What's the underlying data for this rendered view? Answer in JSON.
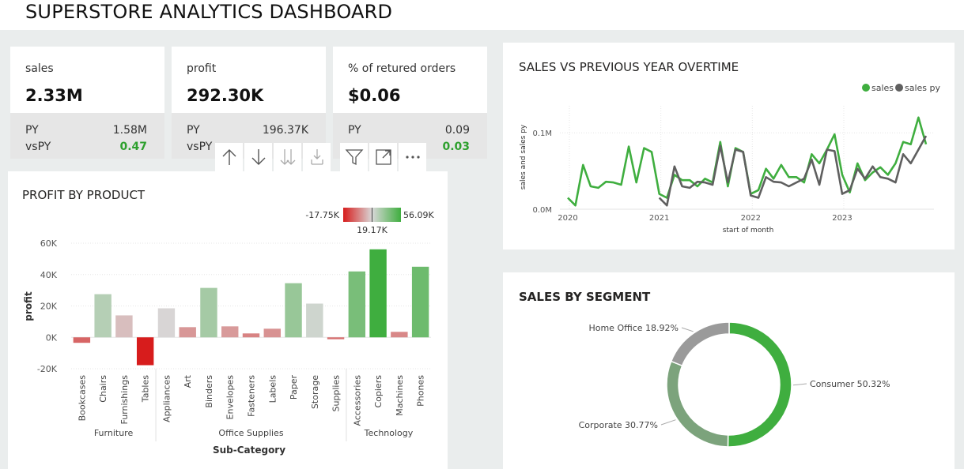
{
  "title": "SUPERSTORE ANALYTICS DASHBOARD",
  "kpis": [
    {
      "label": "sales",
      "value": "2.33M",
      "py_label": "PY",
      "py_value": "1.58M",
      "vspy_label": "vsPY",
      "vspy_value": "0.47"
    },
    {
      "label": "profit",
      "value": "292.30K",
      "py_label": "PY",
      "py_value": "196.37K",
      "vspy_label": "vsPY",
      "vspy_value": ""
    },
    {
      "label": "% of retured orders",
      "value": "$0.06",
      "py_label": "PY",
      "py_value": "0.09",
      "vspy_label": "vs",
      "vspy_value": "0.03"
    }
  ],
  "toolbar_icons": [
    "arrow-up-icon",
    "arrow-down-icon",
    "double-arrow-down-icon",
    "expand-hierarchy-icon",
    "filter-icon",
    "focus-mode-icon",
    "more-options-icon"
  ],
  "colors": {
    "accent_green": "#3fae3f",
    "grey_line": "#5f5f5f",
    "negative_red": "#d71c1c"
  },
  "profit_panel": {
    "title": "PROFIT BY PRODUCT"
  },
  "line_panel": {
    "title": "SALES VS PREVIOUS YEAR OVERTIME"
  },
  "donut_panel": {
    "title": "SALES BY SEGMENT"
  },
  "chart_data": [
    {
      "type": "bar",
      "title": "PROFIT BY PRODUCT",
      "xlabel": "Sub-Category",
      "ylabel": "profit",
      "ylim": [
        -20000,
        60000
      ],
      "yticks": [
        -20000,
        0,
        20000,
        40000,
        60000
      ],
      "ytick_labels": [
        "-20K",
        "0K",
        "20K",
        "40K",
        "60K"
      ],
      "legend": {
        "type": "gradient",
        "min_label": "-17.75K",
        "mid_label": "19.17K",
        "max_label": "56.09K",
        "min": -17750,
        "mid": 19170,
        "max": 56090
      },
      "groups": [
        {
          "name": "Furniture",
          "categories": [
            "Bookcases",
            "Chairs",
            "Furnishings",
            "Tables"
          ],
          "values": [
            -3500,
            27500,
            14000,
            -17750
          ]
        },
        {
          "name": "Office Supplies",
          "categories": [
            "Appliances",
            "Art",
            "Binders",
            "Envelopes",
            "Fasteners",
            "Labels",
            "Paper",
            "Storage",
            "Supplies"
          ],
          "values": [
            18500,
            6500,
            31500,
            7000,
            2500,
            5500,
            34500,
            21500,
            -1200
          ]
        },
        {
          "name": "Technology",
          "categories": [
            "Accessories",
            "Copiers",
            "Machines",
            "Phones"
          ],
          "values": [
            42000,
            56090,
            3500,
            45000
          ]
        }
      ]
    },
    {
      "type": "line",
      "title": "SALES VS PREVIOUS YEAR OVERTIME",
      "xlabel": "start of month",
      "ylabel": "sales and sales py",
      "x_start": "2020-01",
      "x_ticks": [
        "2020",
        "2021",
        "2022",
        "2023"
      ],
      "ytick_labels": [
        "0.0M",
        "0.1M"
      ],
      "yticks": [
        0,
        0.1
      ],
      "ylim": [
        0,
        0.125
      ],
      "legend_position": "top-right",
      "series": [
        {
          "name": "sales",
          "color": "#3fae3f",
          "values": [
            0.015,
            0.005,
            0.058,
            0.03,
            0.028,
            0.036,
            0.035,
            0.032,
            0.082,
            0.035,
            0.08,
            0.075,
            0.02,
            0.015,
            0.045,
            0.038,
            0.038,
            0.03,
            0.04,
            0.035,
            0.088,
            0.03,
            0.08,
            0.075,
            0.02,
            0.025,
            0.053,
            0.04,
            0.058,
            0.042,
            0.042,
            0.035,
            0.072,
            0.06,
            0.078,
            0.098,
            0.045,
            0.022,
            0.06,
            0.038,
            0.048,
            0.055,
            0.045,
            0.06,
            0.088,
            0.085,
            0.12,
            0.085
          ]
        },
        {
          "name": "sales py",
          "color": "#5f5f5f",
          "values": [
            null,
            null,
            null,
            null,
            null,
            null,
            null,
            null,
            null,
            null,
            null,
            null,
            0.015,
            0.005,
            0.056,
            0.03,
            0.028,
            0.036,
            0.035,
            0.032,
            0.083,
            0.035,
            0.078,
            0.075,
            0.018,
            0.015,
            0.042,
            0.036,
            0.035,
            0.03,
            0.035,
            0.04,
            0.065,
            0.032,
            0.078,
            0.076,
            0.02,
            0.025,
            0.053,
            0.04,
            0.056,
            0.042,
            0.04,
            0.035,
            0.072,
            0.06,
            0.078,
            0.096
          ]
        }
      ]
    },
    {
      "type": "pie",
      "title": "SALES BY SEGMENT",
      "categories": [
        "Consumer",
        "Corporate",
        "Home Office"
      ],
      "values": [
        50.32,
        30.77,
        18.92
      ],
      "labels": [
        "Consumer 50.32%",
        "Corporate 30.77%",
        "Home Office 18.92%"
      ],
      "colors": [
        "#3fae3f",
        "#7ca37c",
        "#9a9a9a"
      ]
    }
  ]
}
